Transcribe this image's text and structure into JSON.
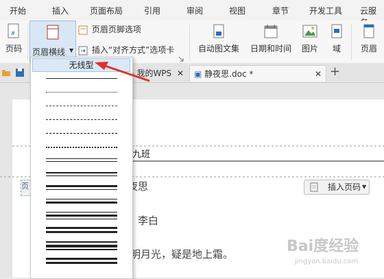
{
  "menu": {
    "tabs": [
      "开始",
      "插入",
      "页面布局",
      "引用",
      "审阅",
      "视图",
      "章节",
      "开发工具",
      "云服务"
    ]
  },
  "ribbon": {
    "page_number": "页码",
    "header_line": "页眉横线",
    "header_footer_options": "页眉页脚选项",
    "insert_alignment_tab": "插入“对齐方式”选项卡",
    "auto_text": "自动图文集",
    "date_time": "日期和时间",
    "picture": "图片",
    "field": "域",
    "header": "页眉"
  },
  "tabs": {
    "my_wps": "我的WPS",
    "doc": "静夜思.doc *",
    "add": "+"
  },
  "dropdown": {
    "no_line": "无线型"
  },
  "document": {
    "header_text": "九班",
    "header_label": "页",
    "title_fragment": "夜思",
    "author_fragment": "：李白",
    "line1_fragment": "明月光，疑是地上霜。",
    "insert_page_number": "插入页码"
  },
  "watermark": {
    "brand": "Bai度经验",
    "url": "jingyan.baidu.com"
  },
  "colors": {
    "accent_blue": "#2e6fb6",
    "arrow_red": "#e03030"
  }
}
